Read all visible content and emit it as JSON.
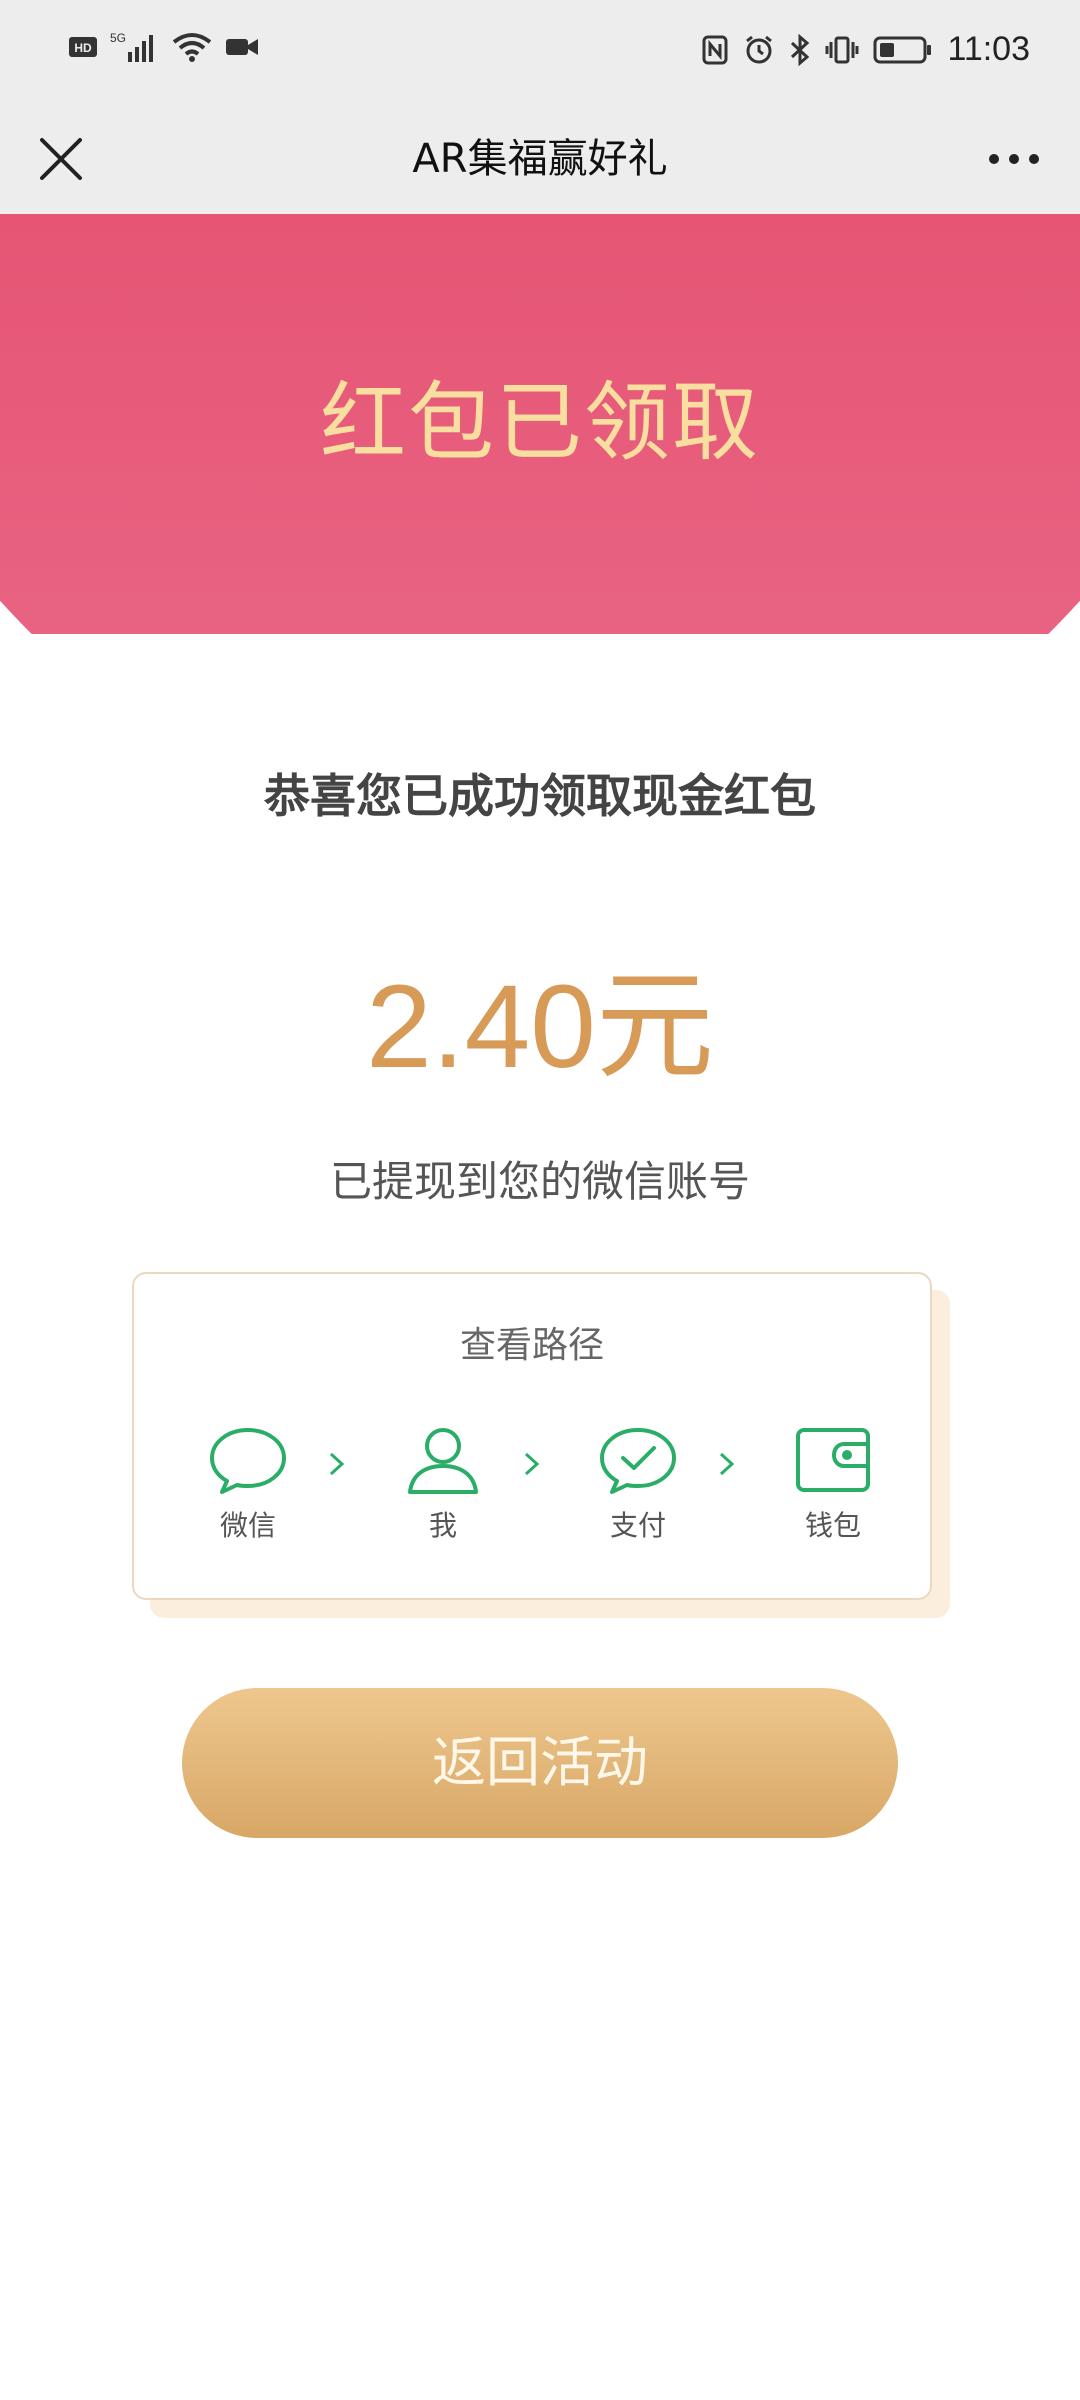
{
  "status_bar": {
    "time": "11:03",
    "left_icons": [
      "hd-icon",
      "5g-signal-icon",
      "wifi-icon",
      "video-icon"
    ],
    "right_icons": [
      "nfc-icon",
      "alarm-icon",
      "bluetooth-icon",
      "vibrate-icon",
      "battery-icon"
    ]
  },
  "nav": {
    "title": "AR集福赢好礼"
  },
  "hero": {
    "title": "红包已领取"
  },
  "main": {
    "congrats": "恭喜您已成功领取现金红包",
    "amount": "2.40元",
    "withdraw_note": "已提现到您的微信账号"
  },
  "path_card": {
    "title": "查看路径",
    "steps": [
      {
        "label": "微信",
        "icon": "chat-bubble-icon"
      },
      {
        "label": "我",
        "icon": "person-icon"
      },
      {
        "label": "支付",
        "icon": "pay-check-icon"
      },
      {
        "label": "钱包",
        "icon": "wallet-icon"
      }
    ]
  },
  "button": {
    "label": "返回活动"
  },
  "colors": {
    "hero_red": "#e5506f",
    "gold_text": "#f9df9f",
    "amount_gold": "#d79a57",
    "wechat_green": "#2aae67"
  }
}
